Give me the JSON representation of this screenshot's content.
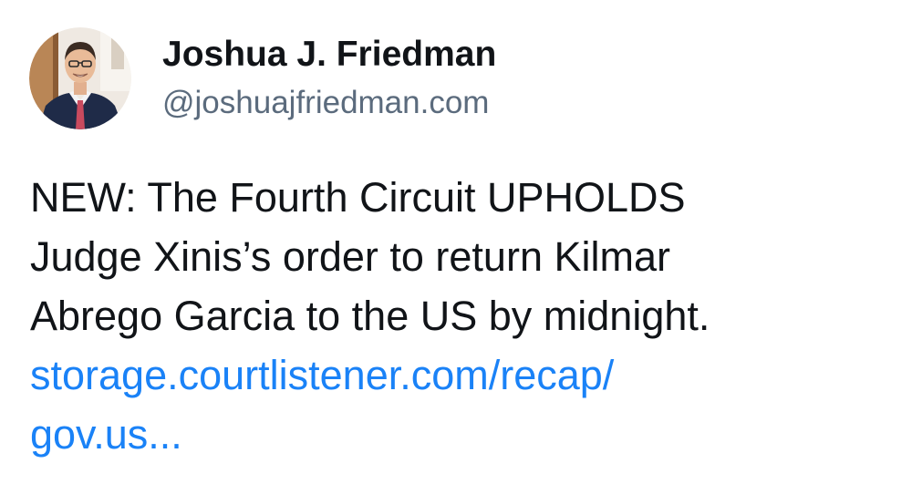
{
  "post": {
    "author": {
      "display_name": "Joshua J. Friedman",
      "handle": "@joshuajfriedman.com",
      "avatar_icon": "profile-photo"
    },
    "body": {
      "lines": [
        "NEW: The Fourth Circuit UPHOLDS",
        "Judge Xinis’s order to return Kilmar",
        "Abrego Garcia to the US by midnight."
      ],
      "link_lines": [
        "storage.courtlistener.com/recap/",
        "gov.us..."
      ]
    },
    "colors": {
      "text": "#111418",
      "handle": "#5b6b7d",
      "link": "#1a82f7"
    }
  }
}
